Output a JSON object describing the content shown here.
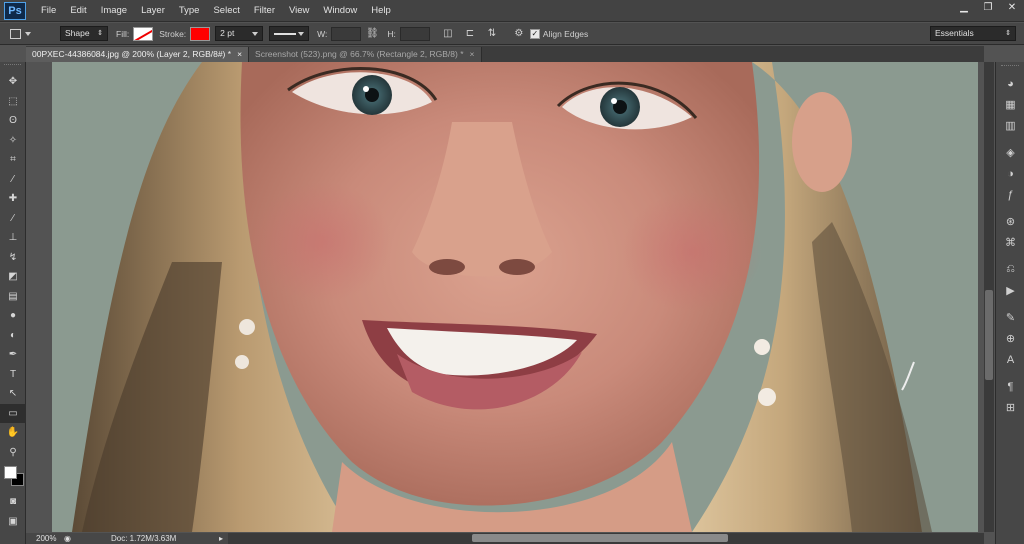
{
  "app": {
    "logo": "Ps"
  },
  "menu": [
    "File",
    "Edit",
    "Image",
    "Layer",
    "Type",
    "Select",
    "Filter",
    "View",
    "Window",
    "Help"
  ],
  "window_controls": {
    "minimize": "▁",
    "restore": "❐",
    "close": "✕"
  },
  "options": {
    "mode": "Shape",
    "fill_label": "Fill:",
    "stroke_label": "Stroke:",
    "stroke_width": "2 pt",
    "w_label": "W:",
    "h_label": "H:",
    "align_edges_label": "Align Edges",
    "workspace": "Essentials",
    "colors": {
      "stroke": "#ff0000",
      "fill": "none"
    }
  },
  "tabs": [
    {
      "label": "00PXEC-44386084.jpg @ 200% (Layer 2, RGB/8#) *",
      "close": "×"
    },
    {
      "label": "Screenshot (523).png @ 66.7% (Rectangle 2, RGB/8) *",
      "close": "×"
    }
  ],
  "tools": [
    {
      "name": "move-tool",
      "glyph": "✥"
    },
    {
      "name": "marquee-tool",
      "glyph": "⬚"
    },
    {
      "name": "lasso-tool",
      "glyph": "ʘ"
    },
    {
      "name": "quick-selection-tool",
      "glyph": "✧"
    },
    {
      "name": "crop-tool",
      "glyph": "⌗"
    },
    {
      "name": "eyedropper-tool",
      "glyph": "⁄"
    },
    {
      "name": "healing-brush-tool",
      "glyph": "✚"
    },
    {
      "name": "brush-tool",
      "glyph": "∕"
    },
    {
      "name": "clone-stamp-tool",
      "glyph": "⊥"
    },
    {
      "name": "history-brush-tool",
      "glyph": "↯"
    },
    {
      "name": "eraser-tool",
      "glyph": "◩"
    },
    {
      "name": "gradient-tool",
      "glyph": "▤"
    },
    {
      "name": "blur-tool",
      "glyph": "●"
    },
    {
      "name": "dodge-tool",
      "glyph": "◐"
    },
    {
      "name": "pen-tool",
      "glyph": "✒"
    },
    {
      "name": "type-tool",
      "glyph": "T"
    },
    {
      "name": "path-selection-tool",
      "glyph": "↖"
    },
    {
      "name": "rectangle-tool",
      "glyph": "▭",
      "active": true
    },
    {
      "name": "hand-tool",
      "glyph": "✋"
    },
    {
      "name": "zoom-tool",
      "glyph": "⚲"
    }
  ],
  "colors": {
    "foreground": "#ffffff",
    "background": "#000000"
  },
  "status": {
    "zoom": "200%",
    "doc": "Doc: 1.72M/3.63M"
  },
  "dock_icons": [
    {
      "name": "color-panel-icon",
      "glyph": "◕"
    },
    {
      "name": "swatches-panel-icon",
      "glyph": "▦"
    },
    {
      "name": "styles-panel-icon",
      "glyph": "▥"
    },
    {
      "name": "layers-panel-icon",
      "glyph": "◈"
    },
    {
      "name": "adjustments-panel-icon",
      "glyph": "◑"
    },
    {
      "name": "fx-panel-icon",
      "glyph": "ƒ"
    },
    {
      "name": "channels-panel-icon",
      "glyph": "⊛"
    },
    {
      "name": "paths-panel-icon",
      "glyph": "⌘"
    },
    {
      "name": "history-panel-icon",
      "glyph": "⎌"
    },
    {
      "name": "actions-panel-icon",
      "glyph": "▶"
    },
    {
      "name": "brush-panel-icon",
      "glyph": "✎"
    },
    {
      "name": "clone-source-panel-icon",
      "glyph": "⊕"
    },
    {
      "name": "character-panel-icon",
      "glyph": "A"
    },
    {
      "name": "paragraph-panel-icon",
      "glyph": "¶"
    },
    {
      "name": "tool-presets-panel-icon",
      "glyph": "⊞"
    }
  ]
}
